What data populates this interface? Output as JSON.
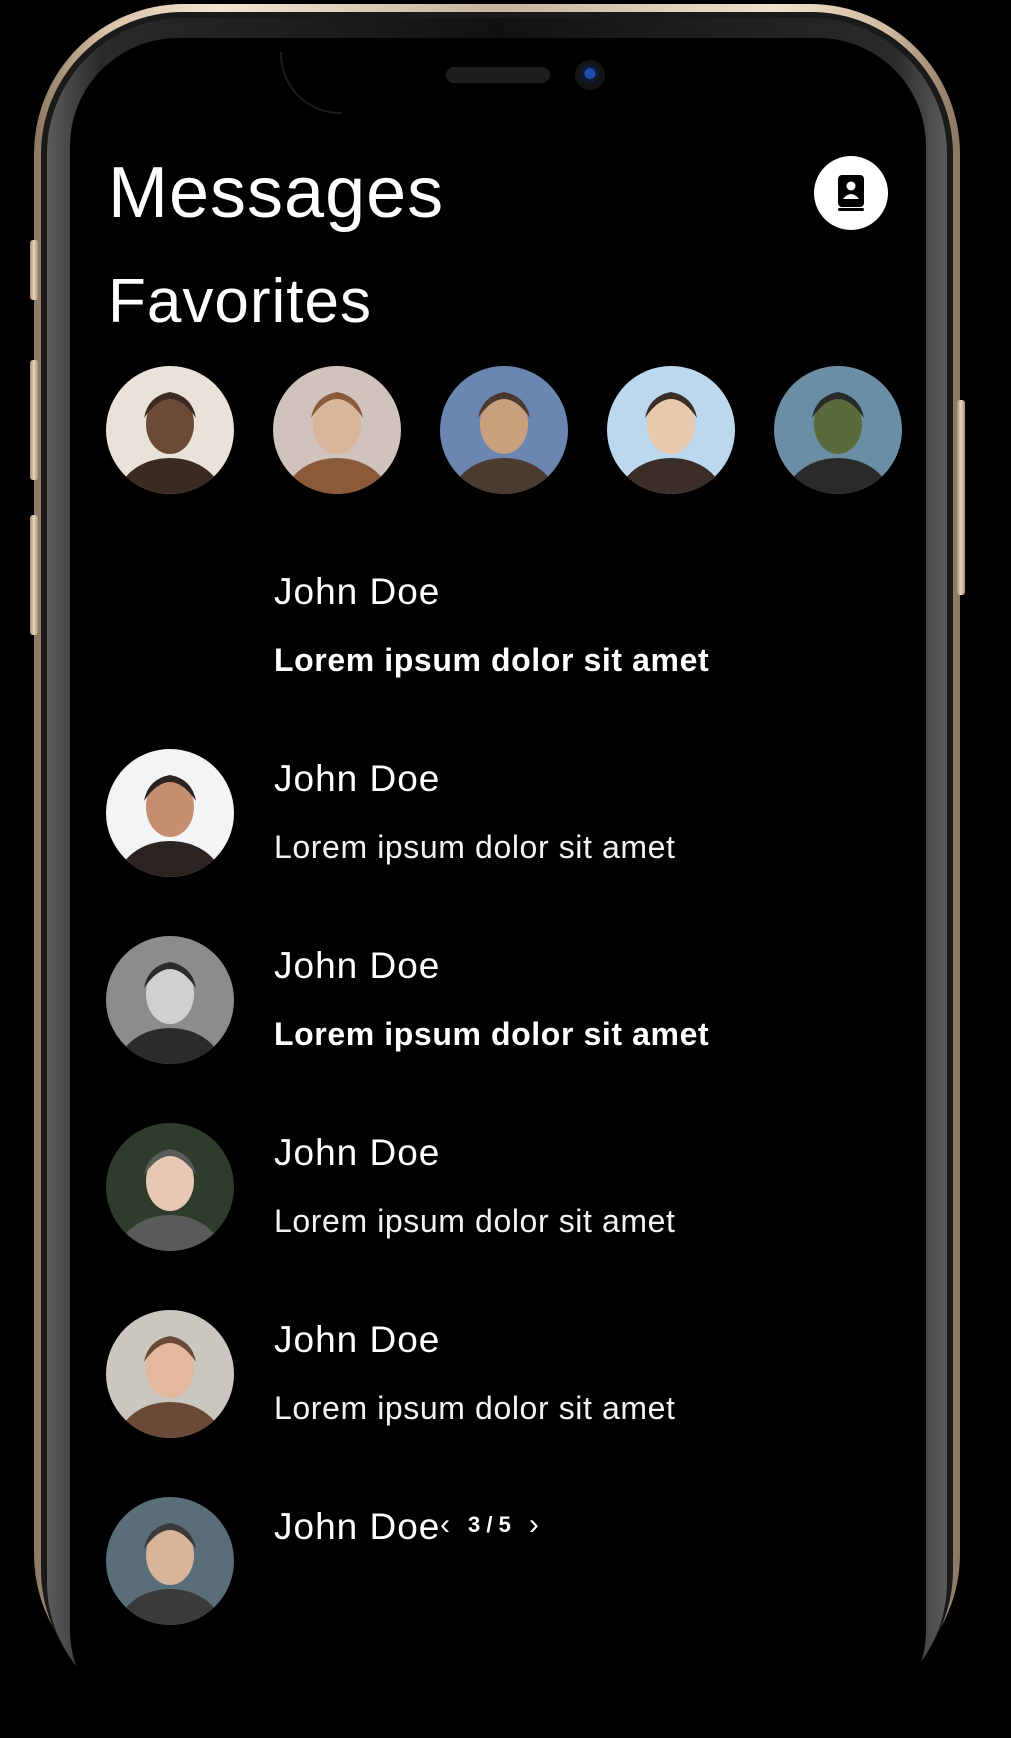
{
  "header": {
    "title": "Messages",
    "contacts_icon": "contacts-book-icon"
  },
  "favorites": {
    "title": "Favorites",
    "avatars": [
      {
        "name": "favorite-avatar-1",
        "colors": [
          "#e8e2d8",
          "#6b4a36",
          "#3a2a22"
        ]
      },
      {
        "name": "favorite-avatar-2",
        "colors": [
          "#cfc3bc",
          "#d9b59c",
          "#8a5a3a"
        ]
      },
      {
        "name": "favorite-avatar-3",
        "colors": [
          "#6c86b2",
          "#c9a07e",
          "#4b3a2e"
        ]
      },
      {
        "name": "favorite-avatar-4",
        "colors": [
          "#bcd8ee",
          "#e8c9ad",
          "#3b2d27"
        ]
      },
      {
        "name": "favorite-avatar-5",
        "colors": [
          "#6a8fa5",
          "#5a6a3a",
          "#2a2a2a"
        ]
      }
    ]
  },
  "messages": [
    {
      "name": "John Doe",
      "preview": "Lorem ipsum dolor sit amet",
      "unread": true,
      "has_avatar": false,
      "colors": [
        "#000",
        "#000",
        "#000"
      ]
    },
    {
      "name": "John Doe",
      "preview": "Lorem ipsum dolor sit amet",
      "unread": false,
      "has_avatar": true,
      "colors": [
        "#f2f4f6",
        "#c58e70",
        "#2a2320"
      ]
    },
    {
      "name": "John Doe",
      "preview": "Lorem ipsum dolor sit amet",
      "unread": true,
      "has_avatar": true,
      "colors": [
        "#8c8c8c",
        "#d0d0d0",
        "#2b2b2b"
      ]
    },
    {
      "name": "John Doe",
      "preview": "Lorem ipsum dolor sit amet",
      "unread": false,
      "has_avatar": true,
      "colors": [
        "#2f3b2b",
        "#e6c8b5",
        "#5a5a5a"
      ]
    },
    {
      "name": "John Doe",
      "preview": "Lorem ipsum dolor sit amet",
      "unread": false,
      "has_avatar": true,
      "colors": [
        "#c9c7c0",
        "#e4b89c",
        "#6a4a36"
      ]
    },
    {
      "name": "John Doe",
      "preview": "",
      "unread": false,
      "has_avatar": true,
      "colors": [
        "#5a6e7a",
        "#d8b49a",
        "#3a3a3a"
      ]
    }
  ],
  "pager": {
    "prev": "‹",
    "label": "3 / 5",
    "next": "›"
  }
}
